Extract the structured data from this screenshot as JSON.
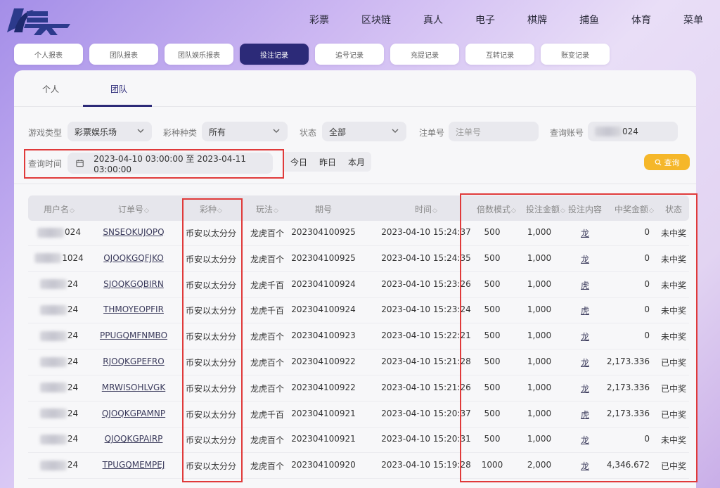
{
  "nav": {
    "items": [
      "彩票",
      "区块链",
      "真人",
      "电子",
      "棋牌",
      "捕鱼",
      "体育",
      "菜单"
    ]
  },
  "report_tabs": [
    {
      "label": "个人报表",
      "active": false
    },
    {
      "label": "团队报表",
      "active": false
    },
    {
      "label": "团队娱乐报表",
      "active": false
    },
    {
      "label": "投注记录",
      "active": true
    },
    {
      "label": "追号记录",
      "active": false
    },
    {
      "label": "充提记录",
      "active": false
    },
    {
      "label": "互转记录",
      "active": false
    },
    {
      "label": "账变记录",
      "active": false
    }
  ],
  "sub_tabs": [
    "个人",
    "团队"
  ],
  "filters": {
    "game_type_label": "游戏类型",
    "game_type_value": "彩票娱乐场",
    "lottery_label": "彩种种类",
    "lottery_value": "所有",
    "status_label": "状态",
    "status_value": "全部",
    "order_label": "注单号",
    "order_placeholder": "注单号",
    "account_label": "查询账号",
    "account_value": "024",
    "time_label": "查询时间",
    "time_range": "2023-04-10 03:00:00 至 2023-04-11 03:00:00",
    "quick": [
      "今日",
      "昨日",
      "本月"
    ],
    "search_label": "查询"
  },
  "table": {
    "headers": [
      "用户名",
      "订单号",
      "彩种",
      "玩法",
      "期号",
      "时间",
      "倍数模式",
      "投注金额",
      "投注内容",
      "中奖金额",
      "状态"
    ],
    "rows": [
      {
        "user": "024",
        "order": "SNSEOKUJOPQ",
        "lottery": "币安以太分分",
        "play": "龙虎百个",
        "issue": "202304100925",
        "time": "2023-04-10 15:24:37",
        "mult": "500",
        "amount": "1,000",
        "content": "龙",
        "win": "0",
        "status": "未中奖"
      },
      {
        "user": "1024",
        "order": "QJOQKGQFJKO",
        "lottery": "币安以太分分",
        "play": "龙虎百个",
        "issue": "202304100925",
        "time": "2023-04-10 15:24:35",
        "mult": "500",
        "amount": "1,000",
        "content": "龙",
        "win": "0",
        "status": "未中奖"
      },
      {
        "user": "24",
        "order": "SJOQKGQBIRN",
        "lottery": "币安以太分分",
        "play": "龙虎千百",
        "issue": "202304100924",
        "time": "2023-04-10 15:23:26",
        "mult": "500",
        "amount": "1,000",
        "content": "虎",
        "win": "0",
        "status": "未中奖"
      },
      {
        "user": "24",
        "order": "THMOYEOPFIR",
        "lottery": "币安以太分分",
        "play": "龙虎千百",
        "issue": "202304100924",
        "time": "2023-04-10 15:23:24",
        "mult": "500",
        "amount": "1,000",
        "content": "虎",
        "win": "0",
        "status": "未中奖"
      },
      {
        "user": "24",
        "order": "PPUGQMFNMBO",
        "lottery": "币安以太分分",
        "play": "龙虎百个",
        "issue": "202304100923",
        "time": "2023-04-10 15:22:21",
        "mult": "500",
        "amount": "1,000",
        "content": "龙",
        "win": "0",
        "status": "未中奖"
      },
      {
        "user": "24",
        "order": "RJOQKGPEFRO",
        "lottery": "币安以太分分",
        "play": "龙虎百个",
        "issue": "202304100922",
        "time": "2023-04-10 15:21:28",
        "mult": "500",
        "amount": "1,000",
        "content": "龙",
        "win": "2,173.336",
        "status": "已中奖"
      },
      {
        "user": "24",
        "order": "MRWISOHLVGK",
        "lottery": "币安以太分分",
        "play": "龙虎百个",
        "issue": "202304100922",
        "time": "2023-04-10 15:21:26",
        "mult": "500",
        "amount": "1,000",
        "content": "龙",
        "win": "2,173.336",
        "status": "已中奖"
      },
      {
        "user": "24",
        "order": "QJOQKGPAMNP",
        "lottery": "币安以太分分",
        "play": "龙虎千百",
        "issue": "202304100921",
        "time": "2023-04-10 15:20:37",
        "mult": "500",
        "amount": "1,000",
        "content": "虎",
        "win": "2,173.336",
        "status": "已中奖"
      },
      {
        "user": "24",
        "order": "QJOQKGPAIRP",
        "lottery": "币安以太分分",
        "play": "龙虎百个",
        "issue": "202304100921",
        "time": "2023-04-10 15:20:31",
        "mult": "500",
        "amount": "1,000",
        "content": "龙",
        "win": "0",
        "status": "未中奖"
      },
      {
        "user": "24",
        "order": "TPUGQMEMPEJ",
        "lottery": "币安以太分分",
        "play": "龙虎百个",
        "issue": "202304100920",
        "time": "2023-04-10 15:19:28",
        "mult": "1000",
        "amount": "2,000",
        "content": "龙",
        "win": "4,346.672",
        "status": "已中奖"
      }
    ]
  },
  "colors": {
    "accent": "#2c2a78",
    "search_button": "#f5b72a",
    "annotation": "#e03a3a"
  }
}
